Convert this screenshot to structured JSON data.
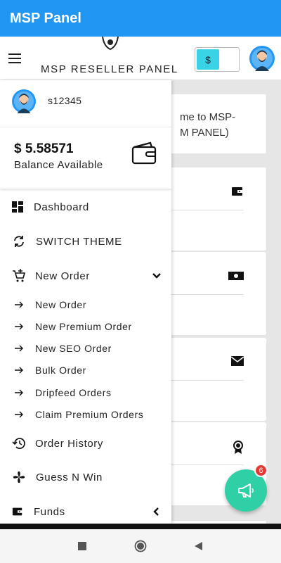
{
  "app_bar": {
    "title": "MSP Panel"
  },
  "header": {
    "brand": "MSP RESELLER PANEL",
    "currency_symbol": "$"
  },
  "welcome": {
    "line1": "me to MSP-",
    "line2": "M PANEL)"
  },
  "drawer": {
    "username": "s12345",
    "balance_amount": "$ 5.58571",
    "balance_label": "Balance Available",
    "items": {
      "dashboard": "Dashboard",
      "switch_theme": "SWITCH THEME",
      "new_order_group": "New Order",
      "order_history": "Order History",
      "guess_n_win": "Guess N Win",
      "funds": "Funds"
    },
    "sub_items": [
      "New Order",
      "New Premium Order",
      "New SEO Order",
      "Bulk Order",
      "Dripfeed Orders",
      "Claim Premium Orders"
    ]
  },
  "fab": {
    "badge_count": "6",
    "icon": "megaphone-icon"
  },
  "colors": {
    "app_bar": "#2196f3",
    "currency_toggle": "#3ad3e6",
    "fab": "#30d0a6",
    "badge": "#e53935"
  }
}
